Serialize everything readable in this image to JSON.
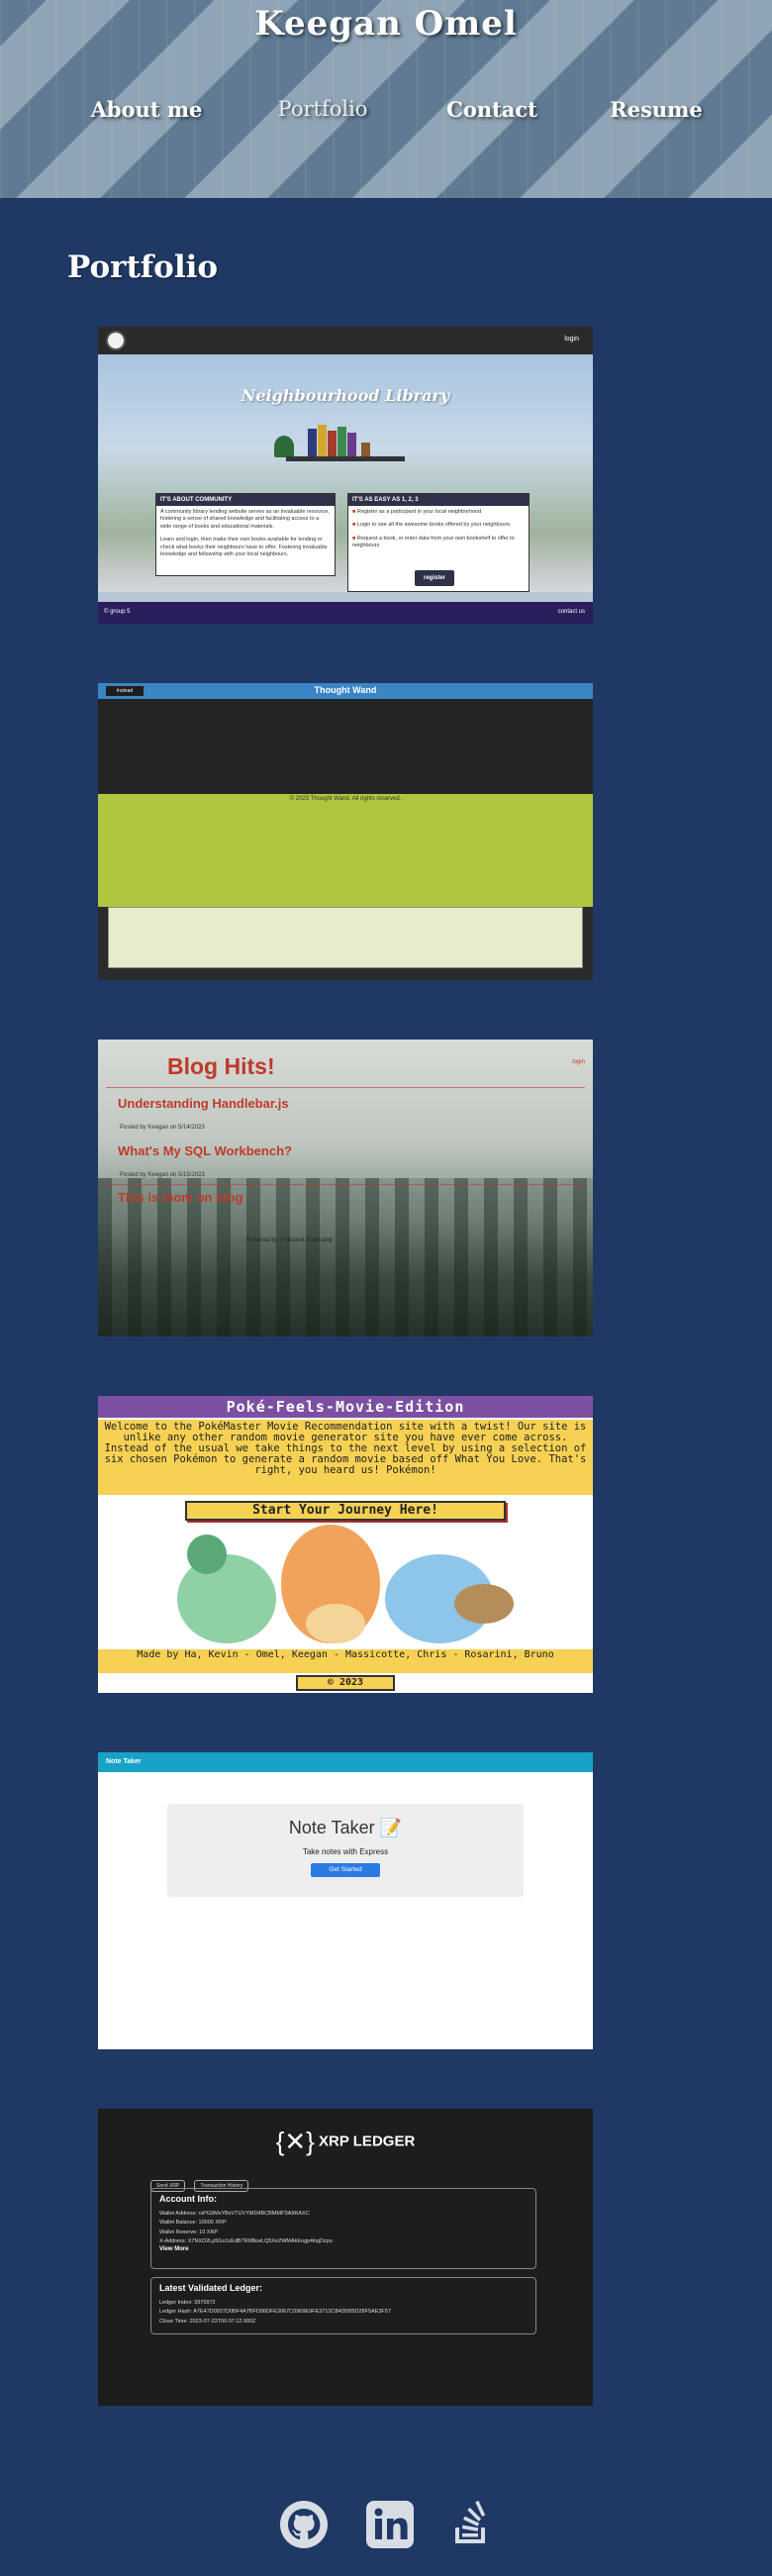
{
  "header": {
    "site_title": "Keegan Omel",
    "nav": [
      {
        "label": "About me"
      },
      {
        "label": "Portfolio"
      },
      {
        "label": "Contact"
      },
      {
        "label": "Resume"
      }
    ]
  },
  "portfolio": {
    "title": "Portfolio",
    "projects": [
      {
        "name": "Neighbourhood Library",
        "login": "login",
        "box1_title": "IT'S ABOUT COMMUNITY",
        "box1_text1": "A community library lending website serves as an invaluable resource, fostering a sense of shared knowledge and facilitating access to a wide range of books and educational materials.",
        "box1_text2": "Learn and login, then make their own books available for lending or check what books their neighbours have to offer. Fostering invaluable knowledge and fellowship with your local neighbours.",
        "box2_title": "IT'S AS EASY AS 1, 2, 3",
        "box2_items": [
          "Register as a participant in your local neighborhood",
          "Login to see all the awesome books offered by your neighbours",
          "Request a book, or enter data from your own bookshelf to offer to neighbours"
        ],
        "register": "register",
        "footer_left": "© group 5",
        "footer_right": "contact us"
      },
      {
        "name": "Thought Wand",
        "button": "Instead",
        "copyright": "© 2023 Thought Wand. All rights reserved."
      },
      {
        "name": "Blog Hits!",
        "login": "login",
        "posts": [
          {
            "title": "Understanding Handlebar.js",
            "meta": "Posted by Keegan on 5/14/2023"
          },
          {
            "title": "What's My SQL Workbench?",
            "meta": "Posted by Keegan on 5/15/2023"
          },
          {
            "title": "This is mom on blog"
          }
        ],
        "footer": "Powered by: Fullstack Bootcamp"
      },
      {
        "name": "Poké-Feels-Movie-Edition",
        "intro": "Welcome to the PokéMaster Movie Recommendation site with a twist! Our site is unlike any other random movie generator site you have ever come across. Instead of the usual we take things to the next level by using a selection of six chosen Pokémon to generate a random movie based off What You Love. That's right, you heard us! Pokémon!",
        "start": "Start Your Journey Here!",
        "made_by": "Made by Ha, Kevin - Omel, Keegan - Massicotte, Chris - Rosarini, Bruno",
        "copyright": "© 2023"
      },
      {
        "name": "Note Taker",
        "title": "Note Taker 📝",
        "subtitle": "Take notes with Express",
        "button": "Get Started"
      },
      {
        "name": "XRP LEDGER",
        "tabs": [
          "Send XRP",
          "Transaction History"
        ],
        "account_title": "Account Info:",
        "account_rows": [
          "Wallet Address: rsPG9MxYBxVTUVYMD4BCBMMP3A9RAXC",
          "Wallet Balance: 10000 XRP",
          "Wallet Reserve: 10 XRP",
          "X-Address: X7NXD2Lp5Gs1zEdB7R6BkwLQ5Xe2WMAkEngpAhgDzpu"
        ],
        "view_more": "View More",
        "ledger_title": "Latest Validated Ledger:",
        "ledger_rows": [
          "Ledger Index: 3970972",
          "Ledger Hash: A7E47D0927D0BF4A7BFD96DFE3067C0969E9FE3713C84DD85D28F5AE3F57",
          "Close Time: 2023-07-23T06:07:12.000Z"
        ]
      }
    ]
  },
  "footer": {
    "icons": [
      "github-icon",
      "linkedin-icon",
      "stackoverflow-icon"
    ]
  },
  "colors": {
    "page_bg": "#1f3864",
    "text": "#ffffff"
  }
}
